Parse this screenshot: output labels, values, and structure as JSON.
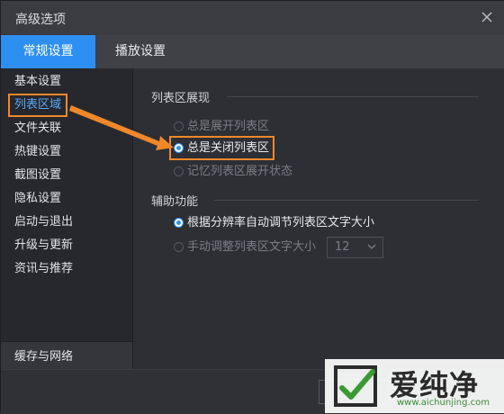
{
  "window": {
    "title": "高级选项"
  },
  "tabs": [
    {
      "label": "常规设置",
      "active": true
    },
    {
      "label": "播放设置",
      "active": false
    }
  ],
  "sidebar": {
    "items": [
      {
        "label": "基本设置"
      },
      {
        "label": "列表区域",
        "selected": true
      },
      {
        "label": "文件关联"
      },
      {
        "label": "热键设置"
      },
      {
        "label": "截图设置"
      },
      {
        "label": "隐私设置"
      },
      {
        "label": "启动与退出"
      },
      {
        "label": "升级与更新"
      },
      {
        "label": "资讯与推荐"
      }
    ],
    "bottom_item": "缓存与网络"
  },
  "list_section": {
    "title": "列表区展现",
    "options": [
      {
        "label": "总是展开列表区",
        "checked": false
      },
      {
        "label": "总是关闭列表区",
        "checked": true
      },
      {
        "label": "记忆列表区展开状态",
        "checked": false
      }
    ]
  },
  "aux_section": {
    "title": "辅助功能",
    "options": [
      {
        "label": "根据分辨率自动调节列表区文字大小",
        "checked": true
      },
      {
        "label": "手动调整列表区文字大小",
        "checked": false
      }
    ],
    "font_size_select": "12"
  },
  "watermark": {
    "brand": "爱纯净",
    "url": "www.aichunjing.com"
  },
  "colors": {
    "accent": "#2e8ff3",
    "highlight": "#f0882a",
    "background": "#2d2f35",
    "sidebar": "#26282d"
  },
  "icons": [
    "close-icon",
    "chevron-down-icon",
    "radio-icon"
  ]
}
